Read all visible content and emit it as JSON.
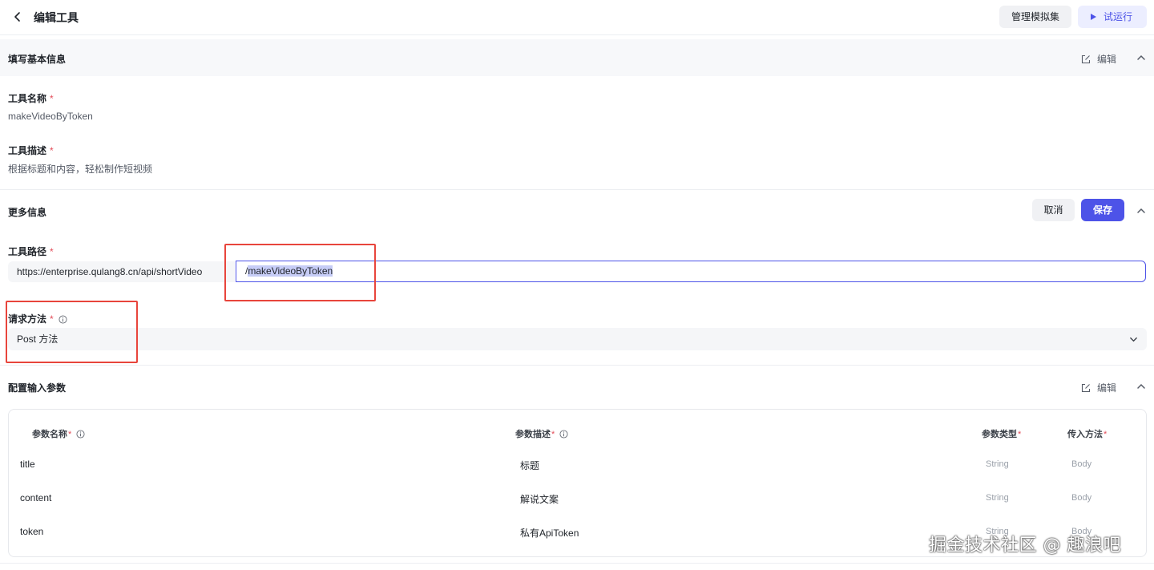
{
  "header": {
    "title": "编辑工具",
    "manage_button": "管理模拟集",
    "run_button": "试运行"
  },
  "basic_info": {
    "section_title": "填写基本信息",
    "edit_label": "编辑",
    "name_label": "工具名称",
    "name_value": "makeVideoByToken",
    "desc_label": "工具描述",
    "desc_value": "根据标题和内容，轻松制作短视频"
  },
  "more_info": {
    "section_title": "更多信息",
    "cancel_button": "取消",
    "save_button": "保存",
    "path_label": "工具路径",
    "path_prefix": "https://enterprise.qulang8.cn/api/shortVideo",
    "path_slash": "/",
    "path_value": "makeVideoByToken",
    "method_label": "请求方法",
    "method_value": "Post 方法"
  },
  "input_params": {
    "section_title": "配置输入参数",
    "edit_label": "编辑",
    "columns": {
      "name": "参数名称",
      "desc": "参数描述",
      "type": "参数类型",
      "method": "传入方法"
    },
    "rows": [
      {
        "name": "title",
        "desc": "标题",
        "type": "String",
        "method": "Body"
      },
      {
        "name": "content",
        "desc": "解说文案",
        "type": "String",
        "method": "Body"
      },
      {
        "name": "token",
        "desc": "私有ApiToken",
        "type": "String",
        "method": "Body"
      }
    ]
  },
  "required_mark": "*",
  "watermark": "掘金技术社区 @ 趣浪吧",
  "colors": {
    "accent": "#4d53e8",
    "required": "#e34d59",
    "annotation_box": "#e8453c"
  }
}
